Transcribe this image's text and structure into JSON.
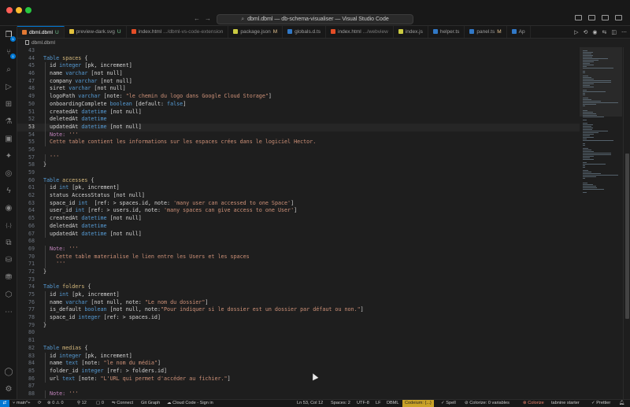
{
  "window": {
    "title": "dbml.dbml — db-schema-visualiser — Visual Studio Code",
    "traffic_colors": [
      "#ff5f57",
      "#febc2e",
      "#28c840"
    ]
  },
  "tabs": [
    {
      "label": "dbml.dbml",
      "status": "U",
      "sub": "",
      "active": true,
      "color": "#e37933"
    },
    {
      "label": "preview-dark.svg",
      "status": "U",
      "sub": "",
      "active": false,
      "color": "#e2c13c"
    },
    {
      "label": "index.html",
      "status": "",
      "sub": ".../dbml-vs-code-extension",
      "active": false,
      "color": "#e44d26"
    },
    {
      "label": "package.json",
      "status": "M",
      "sub": "",
      "active": false,
      "color": "#cbcb41"
    },
    {
      "label": "globals.d.ts",
      "status": "",
      "sub": "",
      "active": false,
      "color": "#3178c6"
    },
    {
      "label": "index.html",
      "status": "",
      "sub": ".../webview",
      "active": false,
      "color": "#e44d26"
    },
    {
      "label": "index.js",
      "status": "",
      "sub": "",
      "active": false,
      "color": "#cbcb41"
    },
    {
      "label": "helper.ts",
      "status": "",
      "sub": "",
      "active": false,
      "color": "#3178c6"
    },
    {
      "label": "panel.ts",
      "status": "M",
      "sub": "",
      "active": false,
      "color": "#3178c6"
    },
    {
      "label": "Ap",
      "status": "",
      "sub": "",
      "active": false,
      "color": "#3178c6"
    }
  ],
  "breadcrumb": {
    "file": "dbml.dbml"
  },
  "activity_badges": {
    "source_control": "1",
    "extensions": "1"
  },
  "editor": {
    "current_line": 53,
    "lines": [
      {
        "n": "43",
        "segs": []
      },
      {
        "n": "44",
        "segs": [
          [
            "kw",
            "Table "
          ],
          [
            "tn",
            "spaces"
          ],
          [
            "pl",
            " {"
          ]
        ]
      },
      {
        "n": "45",
        "segs": [
          [
            "pl",
            "  id "
          ],
          [
            "ty",
            "integer"
          ],
          [
            "pl",
            " [pk, increment]"
          ]
        ]
      },
      {
        "n": "46",
        "segs": [
          [
            "pl",
            "  name "
          ],
          [
            "ty",
            "varchar"
          ],
          [
            "pl",
            " [not null]"
          ]
        ]
      },
      {
        "n": "47",
        "segs": [
          [
            "pl",
            "  company "
          ],
          [
            "ty",
            "varchar"
          ],
          [
            "pl",
            " [not null]"
          ]
        ]
      },
      {
        "n": "48",
        "segs": [
          [
            "pl",
            "  siret "
          ],
          [
            "ty",
            "varchar"
          ],
          [
            "pl",
            " [not null]"
          ]
        ]
      },
      {
        "n": "49",
        "segs": [
          [
            "pl",
            "  logoPath "
          ],
          [
            "ty",
            "varchar"
          ],
          [
            "pl",
            " [note: "
          ],
          [
            "st",
            "\"le chemin du logo dans Google Cloud Storage\""
          ],
          [
            "pl",
            "]"
          ]
        ]
      },
      {
        "n": "50",
        "segs": [
          [
            "pl",
            "  onboardingComplete "
          ],
          [
            "ty",
            "boolean"
          ],
          [
            "pl",
            " [default: "
          ],
          [
            "kw",
            "false"
          ],
          [
            "pl",
            "]"
          ]
        ]
      },
      {
        "n": "51",
        "segs": [
          [
            "pl",
            "  createdAt "
          ],
          [
            "ty",
            "datetime"
          ],
          [
            "pl",
            " [not null]"
          ]
        ]
      },
      {
        "n": "52",
        "segs": [
          [
            "pl",
            "  deletedAt "
          ],
          [
            "ty",
            "datetime"
          ]
        ]
      },
      {
        "n": "53",
        "segs": [
          [
            "pl",
            "  updatedAt "
          ],
          [
            "ty",
            "datetime"
          ],
          [
            "pl",
            " [not null]"
          ]
        ]
      },
      {
        "n": "54",
        "segs": [
          [
            "nt",
            "  Note: "
          ],
          [
            "cm",
            "'''"
          ]
        ]
      },
      {
        "n": "55",
        "segs": [
          [
            "cm",
            "  Cette table contient les informations sur les espaces crées dans le logiciel Hector."
          ]
        ]
      },
      {
        "n": "56",
        "segs": []
      },
      {
        "n": "57",
        "segs": [
          [
            "cm",
            "  '''"
          ]
        ]
      },
      {
        "n": "58",
        "segs": [
          [
            "pl",
            "}"
          ]
        ]
      },
      {
        "n": "59",
        "segs": []
      },
      {
        "n": "60",
        "segs": [
          [
            "kw",
            "Table "
          ],
          [
            "tn",
            "accesses"
          ],
          [
            "pl",
            " {"
          ]
        ]
      },
      {
        "n": "61",
        "segs": [
          [
            "pl",
            "  id "
          ],
          [
            "ty",
            "int"
          ],
          [
            "pl",
            " [pk, increment]"
          ]
        ]
      },
      {
        "n": "62",
        "segs": [
          [
            "pl",
            "  status AccessStatus [not null]"
          ]
        ]
      },
      {
        "n": "63",
        "segs": [
          [
            "pl",
            "  space_id "
          ],
          [
            "ty",
            "int"
          ],
          [
            "pl",
            "  [ref: > spaces.id, note: "
          ],
          [
            "st",
            "'many user can accessed to one Space'"
          ],
          [
            "pl",
            "]"
          ]
        ]
      },
      {
        "n": "64",
        "segs": [
          [
            "pl",
            "  user_id "
          ],
          [
            "ty",
            "int"
          ],
          [
            "pl",
            " [ref: > users.id, note: "
          ],
          [
            "st",
            "'many spaces can give access to one User'"
          ],
          [
            "pl",
            "]"
          ]
        ]
      },
      {
        "n": "65",
        "segs": [
          [
            "pl",
            "  createdAt "
          ],
          [
            "ty",
            "datetime"
          ],
          [
            "pl",
            " [not null]"
          ]
        ]
      },
      {
        "n": "66",
        "segs": [
          [
            "pl",
            "  deletedAt "
          ],
          [
            "ty",
            "datetime"
          ]
        ]
      },
      {
        "n": "67",
        "segs": [
          [
            "pl",
            "  updatedAt "
          ],
          [
            "ty",
            "datetime"
          ],
          [
            "pl",
            " [not null]"
          ]
        ]
      },
      {
        "n": "68",
        "segs": []
      },
      {
        "n": "69",
        "segs": [
          [
            "nt",
            "  Note: "
          ],
          [
            "cm",
            "'''"
          ]
        ]
      },
      {
        "n": "70",
        "segs": [
          [
            "cm",
            "    Cette table materialise le lien entre les Users et les spaces"
          ]
        ]
      },
      {
        "n": "71",
        "segs": [
          [
            "cm",
            "    '''"
          ]
        ]
      },
      {
        "n": "72",
        "segs": [
          [
            "pl",
            "}"
          ]
        ]
      },
      {
        "n": "73",
        "segs": []
      },
      {
        "n": "74",
        "segs": [
          [
            "kw",
            "Table "
          ],
          [
            "tn",
            "folders"
          ],
          [
            "pl",
            " {"
          ]
        ]
      },
      {
        "n": "75",
        "segs": [
          [
            "pl",
            "  id "
          ],
          [
            "ty",
            "int"
          ],
          [
            "pl",
            " [pk, increment]"
          ]
        ]
      },
      {
        "n": "76",
        "segs": [
          [
            "pl",
            "  name "
          ],
          [
            "ty",
            "varchar"
          ],
          [
            "pl",
            " [not null, note: "
          ],
          [
            "st",
            "\"Le nom du dossier\""
          ],
          [
            "pl",
            "]"
          ]
        ]
      },
      {
        "n": "77",
        "segs": [
          [
            "pl",
            "  is_default "
          ],
          [
            "ty",
            "boolean"
          ],
          [
            "pl",
            " [not null, note:"
          ],
          [
            "st",
            "\"Pour indiquer si le dossier est un dossier par défaut ou non.\""
          ],
          [
            "pl",
            "]"
          ]
        ]
      },
      {
        "n": "78",
        "segs": [
          [
            "pl",
            "  space_id "
          ],
          [
            "ty",
            "integer"
          ],
          [
            "pl",
            " [ref: > spaces.id]"
          ]
        ]
      },
      {
        "n": "79",
        "segs": [
          [
            "pl",
            "}"
          ]
        ]
      },
      {
        "n": "80",
        "segs": []
      },
      {
        "n": "81",
        "segs": []
      },
      {
        "n": "82",
        "segs": [
          [
            "kw",
            "Table "
          ],
          [
            "tn",
            "medias"
          ],
          [
            "pl",
            " {"
          ]
        ]
      },
      {
        "n": "83",
        "segs": [
          [
            "pl",
            "  id "
          ],
          [
            "ty",
            "integer"
          ],
          [
            "pl",
            " [pk, increment]"
          ]
        ]
      },
      {
        "n": "84",
        "segs": [
          [
            "pl",
            "  name "
          ],
          [
            "ty",
            "text"
          ],
          [
            "pl",
            " [note: "
          ],
          [
            "st",
            "\"le nom du média\""
          ],
          [
            "pl",
            "]"
          ]
        ]
      },
      {
        "n": "85",
        "segs": [
          [
            "pl",
            "  folder_id "
          ],
          [
            "ty",
            "integer"
          ],
          [
            "pl",
            " [ref: > folders.id]"
          ]
        ]
      },
      {
        "n": "86",
        "segs": [
          [
            "pl",
            "  url "
          ],
          [
            "ty",
            "text"
          ],
          [
            "pl",
            " [note: "
          ],
          [
            "st",
            "\"L'URL qui permet d'accéder au fichier.\""
          ],
          [
            "pl",
            "]"
          ]
        ]
      },
      {
        "n": "87",
        "segs": []
      },
      {
        "n": "88",
        "segs": [
          [
            "nt",
            "  Note: "
          ],
          [
            "cm",
            "'''"
          ]
        ]
      }
    ]
  },
  "statusbar": {
    "branch": "main*+",
    "sync": "⟳",
    "problems": "⊗ 0 ⚠ 0",
    "ports": "12",
    "notif": "0",
    "connect": "Connect",
    "git_graph": "Git Graph",
    "cloud_code": "Cloud Code - Sign in",
    "position": "Ln 53, Col 12",
    "spaces": "Spaces: 2",
    "encoding": "UTF-8",
    "eol": "LF",
    "language": "DBML",
    "codeium": "Codeium: {...}",
    "spell": "Spell",
    "colorize_vars": "Colorize: 0 variables",
    "colorize": "Colorize",
    "tabnine": "tabnine starter",
    "prettier": "Prettier"
  }
}
